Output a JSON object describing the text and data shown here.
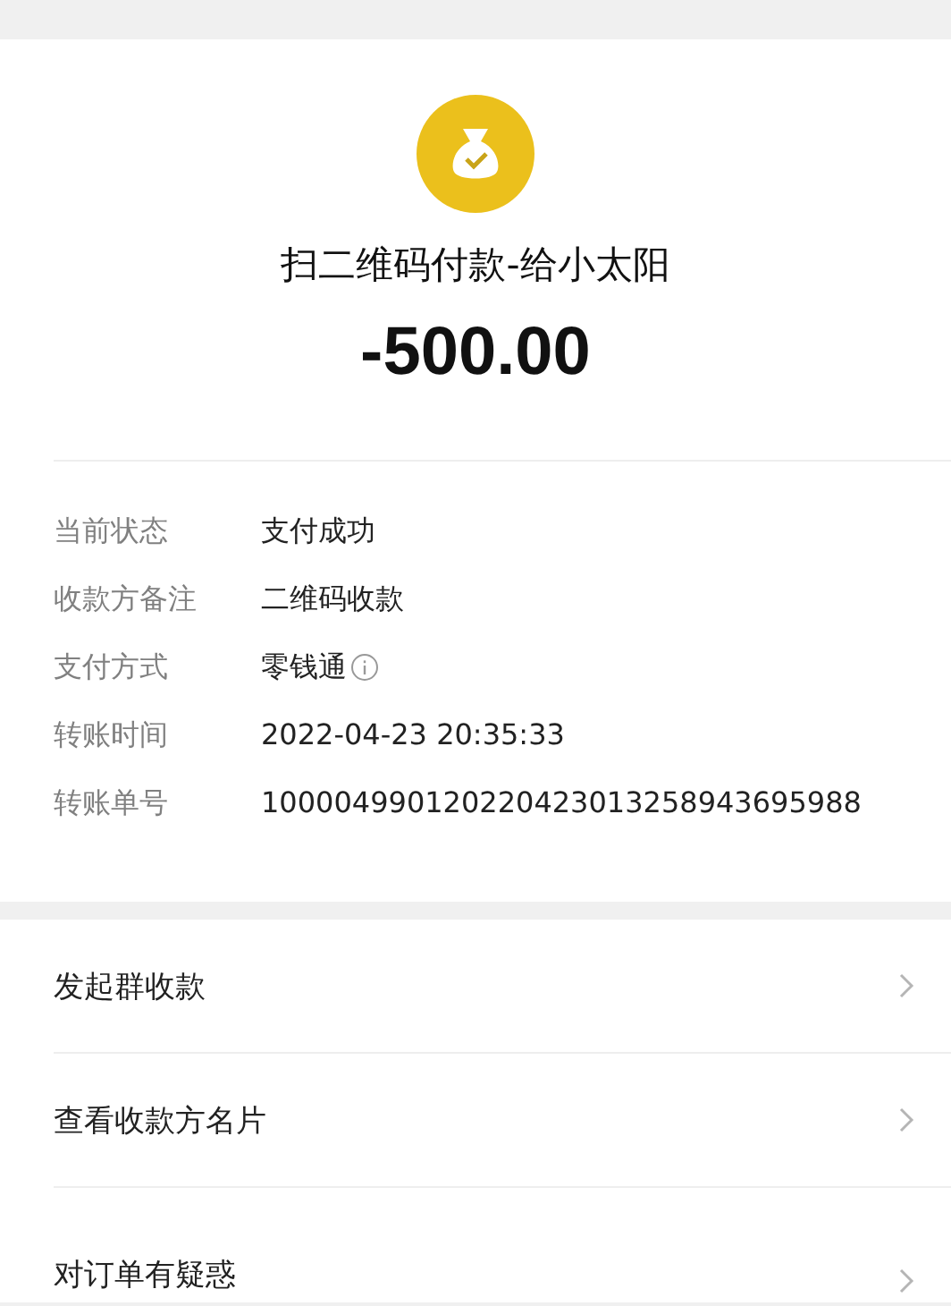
{
  "summary": {
    "title": "扫二维码付款-给小太阳",
    "amount": "-500.00"
  },
  "details": [
    {
      "label": "当前状态",
      "value": "支付成功",
      "info": false
    },
    {
      "label": "收款方备注",
      "value": "二维码收款",
      "info": false
    },
    {
      "label": "支付方式",
      "value": "零钱通",
      "info": true
    },
    {
      "label": "转账时间",
      "value": "2022-04-23 20:35:33",
      "info": false
    },
    {
      "label": "转账单号",
      "value": "100004990120220423013258943695988",
      "info": false
    }
  ],
  "actions": [
    {
      "label": "发起群收款"
    },
    {
      "label": "查看收款方名片"
    },
    {
      "label": "对订单有疑惑"
    }
  ]
}
